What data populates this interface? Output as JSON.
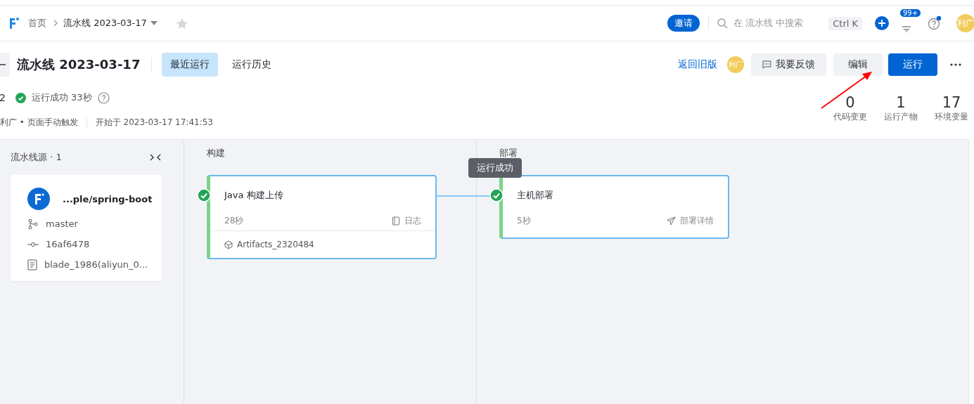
{
  "top_bar": {
    "breadcrumbs": [
      {
        "label": "首页"
      },
      {
        "label": "流水线 2023-03-17"
      }
    ],
    "starred": false,
    "invite": "邀请",
    "search": {
      "placeholder": "在 流水线 中搜索",
      "shortcut": "Ctrl K"
    },
    "notification_badge": "99+",
    "help_has_dot": true,
    "avatar": "利广"
  },
  "header": {
    "title": "流水线 2023-03-17",
    "tabs": [
      {
        "label": "最近运行",
        "selected": true
      },
      {
        "label": "运行历史",
        "selected": false
      }
    ],
    "back_old": "返回旧版",
    "avatar": "利广",
    "feedback": "我要反馈",
    "edit": "编辑",
    "run": "运行"
  },
  "run": {
    "number": "2",
    "status": "运行成功 33秒",
    "trigger": "利广 • 页面手动触发",
    "started": "开始于 2023-03-17 17:41:53"
  },
  "stats": [
    {
      "value": "0",
      "label": "代码变更"
    },
    {
      "value": "1",
      "label": "运行产物"
    },
    {
      "value": "17",
      "label": "环境变量"
    }
  ],
  "source": {
    "title": "流水线源 · 1",
    "repo": "...ple/spring-boot",
    "branch": "master",
    "commit": "16af6478",
    "message": "blade_1986(aliyun_0..."
  },
  "stages": [
    {
      "title": "构建",
      "jobs": [
        {
          "name": "Java 构建上传",
          "duration": "28秒",
          "action": "日志",
          "kind": "log",
          "artifact": "Artifacts_2320484"
        }
      ]
    },
    {
      "title": "部署",
      "jobs": [
        {
          "name": "主机部署",
          "duration": "5秒",
          "action": "部署详情",
          "kind": "deploy",
          "tooltip": "运行成功"
        }
      ]
    }
  ]
}
